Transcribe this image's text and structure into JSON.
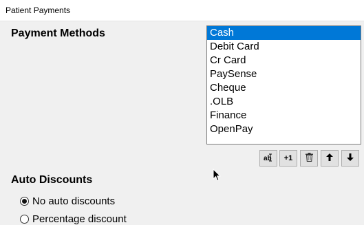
{
  "window": {
    "title": "Patient Payments"
  },
  "payment_methods": {
    "heading": "Payment Methods",
    "items": [
      {
        "label": "Cash",
        "selected": true
      },
      {
        "label": "Debit Card",
        "selected": false
      },
      {
        "label": "Cr Card",
        "selected": false
      },
      {
        "label": "PaySense",
        "selected": false
      },
      {
        "label": "Cheque",
        "selected": false
      },
      {
        "label": ".OLB",
        "selected": false
      },
      {
        "label": "Finance",
        "selected": false
      },
      {
        "label": "OpenPay",
        "selected": false
      }
    ],
    "toolbar": {
      "edit_icon": "edit-icon",
      "add_label": "+1",
      "delete_icon": "trash-icon",
      "up_icon": "arrow-up-icon",
      "down_icon": "arrow-down-icon"
    }
  },
  "auto_discounts": {
    "heading": "Auto Discounts",
    "options": [
      {
        "label": "No auto discounts",
        "checked": true
      },
      {
        "label": "Percentage discount",
        "checked": false
      }
    ]
  },
  "colors": {
    "selection": "#0078d7",
    "background": "#f0f0f0"
  }
}
